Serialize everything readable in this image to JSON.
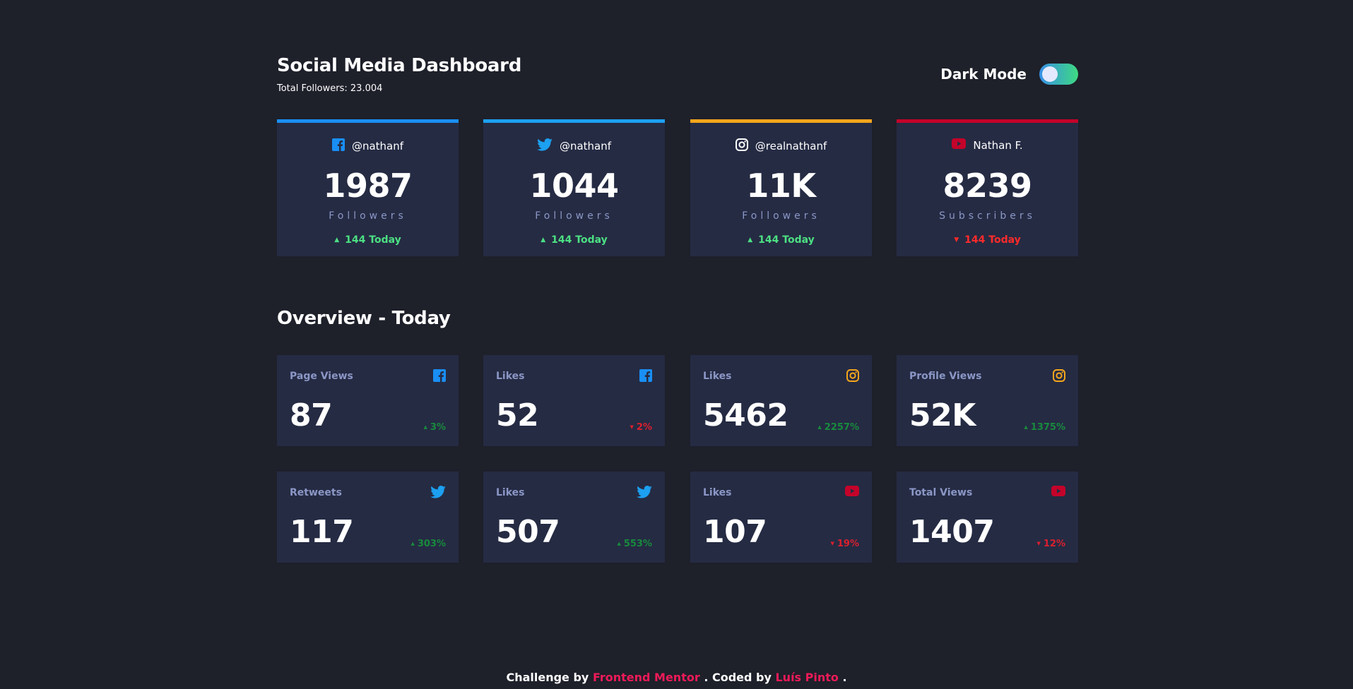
{
  "header": {
    "title": "Social Media Dashboard",
    "subtitle": "Total Followers: 23.004",
    "toggle_label": "Dark Mode",
    "toggle_on": true
  },
  "follower_cards": [
    {
      "platform_icon": "facebook-icon",
      "handle": "@nathanf",
      "count": "1987",
      "label": "Followers",
      "change": "144 Today",
      "trend": "up",
      "accent": "#198ff5"
    },
    {
      "platform_icon": "twitter-icon",
      "handle": "@nathanf",
      "count": "1044",
      "label": "Followers",
      "change": "144 Today",
      "trend": "up",
      "accent": "#1ca0f2"
    },
    {
      "platform_icon": "instagram-icon",
      "handle": "@realnathanf",
      "count": "11K",
      "label": "Followers",
      "change": "144 Today",
      "trend": "up",
      "accent": "#f4a51c"
    },
    {
      "platform_icon": "youtube-icon",
      "handle": "Nathan F.",
      "count": "8239",
      "label": "Subscribers",
      "change": "144 Today",
      "trend": "down",
      "accent": "#c4032a"
    }
  ],
  "overview": {
    "title": "Overview - Today",
    "cards": [
      {
        "label": "Page Views",
        "icon": "facebook-icon",
        "value": "87",
        "change": "3%",
        "trend": "up"
      },
      {
        "label": "Likes",
        "icon": "facebook-icon",
        "value": "52",
        "change": "2%",
        "trend": "down"
      },
      {
        "label": "Likes",
        "icon": "instagram-icon",
        "value": "5462",
        "change": "2257%",
        "trend": "up"
      },
      {
        "label": "Profile Views",
        "icon": "instagram-icon",
        "value": "52K",
        "change": "1375%",
        "trend": "up"
      },
      {
        "label": "Retweets",
        "icon": "twitter-icon",
        "value": "117",
        "change": "303%",
        "trend": "up"
      },
      {
        "label": "Likes",
        "icon": "twitter-icon",
        "value": "507",
        "change": "553%",
        "trend": "up"
      },
      {
        "label": "Likes",
        "icon": "youtube-icon",
        "value": "107",
        "change": "19%",
        "trend": "down"
      },
      {
        "label": "Total Views",
        "icon": "youtube-icon",
        "value": "1407",
        "change": "12%",
        "trend": "down"
      }
    ]
  },
  "footer": {
    "prefix": "Challenge by",
    "challenge_link": "Frontend Mentor",
    "middle": ". Coded by",
    "author_link": "Luís Pinto",
    "suffix": "."
  },
  "colors": {
    "background": "#1e202a",
    "card": "#252b43",
    "facebook": "#198ff5",
    "twitter": "#1ca0f2",
    "instagram": "#f4a51c",
    "youtube": "#c4032a",
    "up": "#1db489",
    "down": "#dc414c",
    "link": "#ef1a58"
  }
}
